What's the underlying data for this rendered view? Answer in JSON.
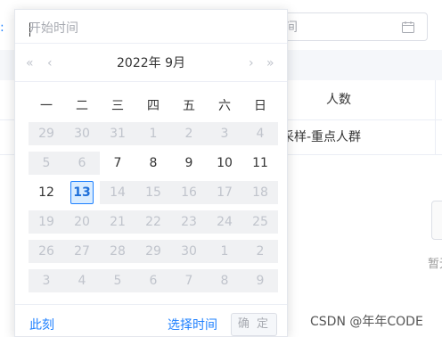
{
  "background": {
    "label_colon": ":",
    "end_placeholder": "间",
    "table_header": "人数",
    "row_cell": "采样-重点人群",
    "empty_text": "暂无"
  },
  "picker": {
    "start_placeholder": "开始时间",
    "title": "2022年 9月",
    "nav": {
      "prev_year": "«",
      "prev_month": "‹",
      "next_month": "›",
      "next_year": "»"
    },
    "weekdays": [
      "一",
      "二",
      "三",
      "四",
      "五",
      "六",
      "日"
    ],
    "days": [
      [
        "29",
        "30",
        "31",
        "1",
        "2",
        "3",
        "4"
      ],
      [
        "5",
        "6",
        "7",
        "8",
        "9",
        "10",
        "11"
      ],
      [
        "12",
        "13",
        "14",
        "15",
        "16",
        "17",
        "18"
      ],
      [
        "19",
        "20",
        "21",
        "22",
        "23",
        "24",
        "25"
      ],
      [
        "26",
        "27",
        "28",
        "29",
        "30",
        "1",
        "2"
      ],
      [
        "3",
        "4",
        "5",
        "6",
        "7",
        "8",
        "9"
      ]
    ],
    "day_state": [
      [
        "dis",
        "dis",
        "dis",
        "dis",
        "dis",
        "dis",
        "dis"
      ],
      [
        "dis",
        "dis",
        "cur",
        "cur",
        "cur",
        "cur",
        "cur"
      ],
      [
        "cur",
        "today",
        "dis",
        "dis",
        "dis",
        "dis",
        "dis"
      ],
      [
        "dis",
        "dis",
        "dis",
        "dis",
        "dis",
        "dis",
        "dis"
      ],
      [
        "dis",
        "dis",
        "dis",
        "dis",
        "dis",
        "dis",
        "dis"
      ],
      [
        "dis",
        "dis",
        "dis",
        "dis",
        "dis",
        "dis",
        "dis"
      ]
    ],
    "footer": {
      "now": "此刻",
      "select_time": "选择时间",
      "confirm": "确 定"
    }
  },
  "watermark": "CSDN @年年CODE",
  "colors": {
    "accent": "#1e80ff",
    "disabled_bg": "#f0f1f3",
    "disabled_text": "#c0c4cc"
  }
}
